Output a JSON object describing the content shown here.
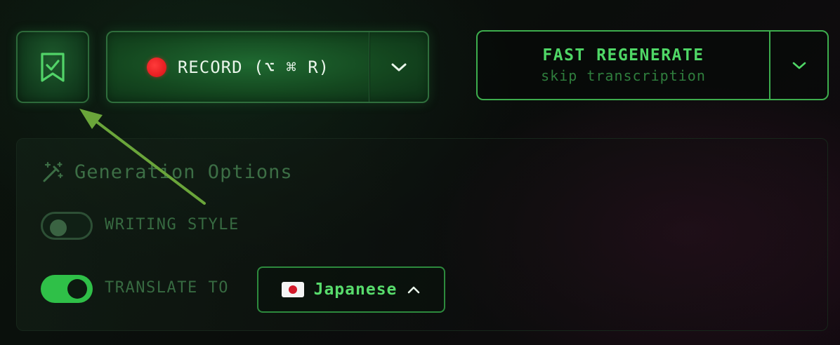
{
  "toolbar": {
    "bookmark": {
      "icon": "bookmark-check-icon"
    },
    "record": {
      "label": "RECORD (⌥ ⌘ R)",
      "dot_color": "#e51a1f",
      "chevron_icon": "chevron-down-icon"
    },
    "fast_regenerate": {
      "title": "FAST REGENERATE",
      "subtitle": "skip transcription",
      "chevron_icon": "chevron-down-icon"
    }
  },
  "generation_options": {
    "icon": "magic-wand-icon",
    "title": "Generation Options",
    "writing_style": {
      "label": "WRITING STYLE",
      "enabled": false
    },
    "translate_to": {
      "label": "TRANSLATE TO",
      "enabled": true,
      "language": "Japanese",
      "flag_icon": "japan-flag-icon",
      "chevron_icon": "chevron-up-icon"
    }
  },
  "annotation": {
    "icon": "pointer-arrow-icon",
    "color": "#6aa53a"
  },
  "colors": {
    "accent_green": "#3dad4d",
    "bright_green": "#4fd766",
    "muted_green": "#376a41"
  }
}
